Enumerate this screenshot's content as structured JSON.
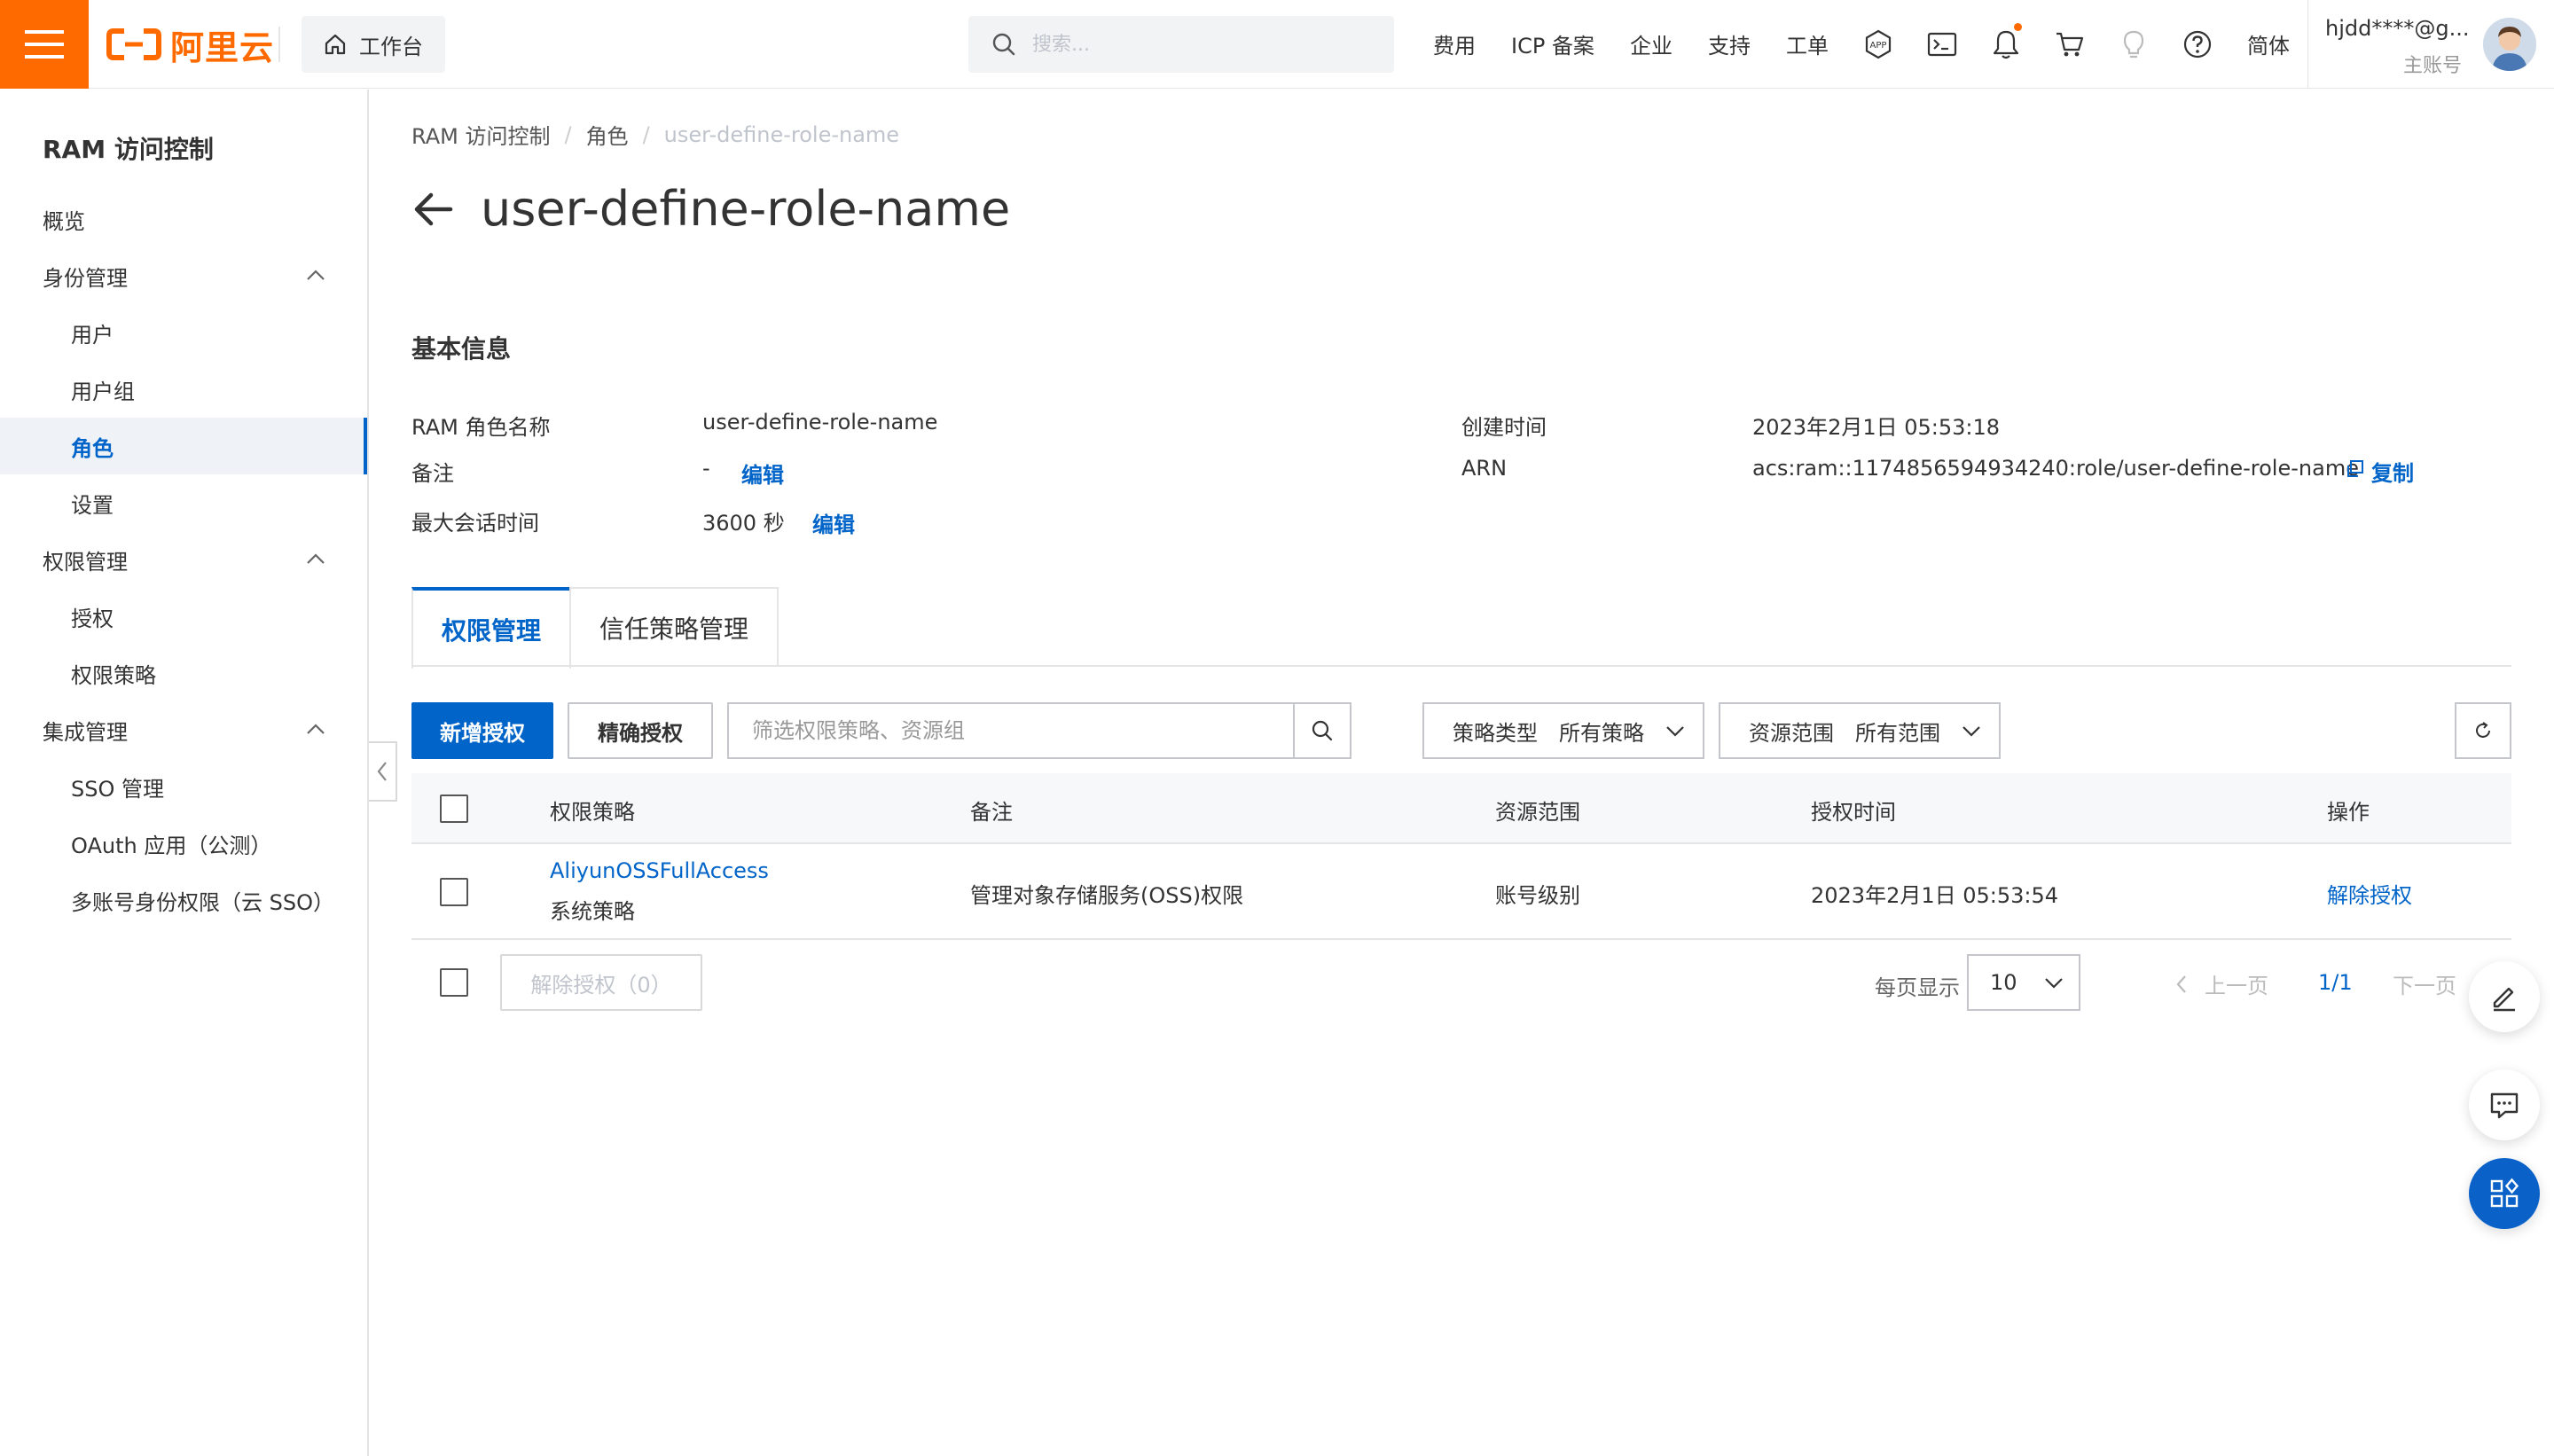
{
  "topbar": {
    "logo_text": "阿里云",
    "workbench_label": "工作台",
    "search_placeholder": "搜索...",
    "nav_links": [
      "费用",
      "ICP 备案",
      "企业",
      "支持",
      "工单"
    ],
    "language": "简体",
    "user_name": "hjdd****@g...",
    "user_role": "主账号",
    "icons": [
      "menu-icon",
      "home-icon",
      "search-icon",
      "app-icon",
      "terminal-icon",
      "bell-icon",
      "cart-icon",
      "lightbulb-icon",
      "help-icon"
    ]
  },
  "sidebar": {
    "title": "RAM 访问控制",
    "items": [
      {
        "label": "概览"
      },
      {
        "label": "身份管理"
      },
      {
        "label": "用户"
      },
      {
        "label": "用户组"
      },
      {
        "label": "角色"
      },
      {
        "label": "设置"
      },
      {
        "label": "权限管理"
      },
      {
        "label": "授权"
      },
      {
        "label": "权限策略"
      },
      {
        "label": "集成管理"
      },
      {
        "label": "SSO 管理"
      },
      {
        "label": "OAuth 应用（公测）"
      },
      {
        "label": "多账号身份权限（云 SSO）"
      }
    ]
  },
  "breadcrumb": {
    "items": [
      "RAM 访问控制",
      "角色",
      "user-define-role-name"
    ],
    "separator": "/"
  },
  "page": {
    "title": "user-define-role-name"
  },
  "basic_info": {
    "section_title": "基本信息",
    "role_name_label": "RAM 角色名称",
    "role_name_value": "user-define-role-name",
    "remark_label": "备注",
    "remark_value": "-",
    "edit_label": "编辑",
    "max_session_label": "最大会话时间",
    "max_session_value": "3600 秒",
    "created_label": "创建时间",
    "created_value": "2023年2月1日 05:53:18",
    "arn_label": "ARN",
    "arn_value": "acs:ram::1174856594934240:role/user-define-role-name",
    "copy_label": "复制"
  },
  "tabs": [
    {
      "label": "权限管理"
    },
    {
      "label": "信任策略管理"
    }
  ],
  "toolbar": {
    "add_grant_label": "新增授权",
    "precise_grant_label": "精确授权",
    "filter_placeholder": "筛选权限策略、资源组",
    "policy_type_label": "策略类型",
    "policy_type_value": "所有策略",
    "resource_scope_label": "资源范围",
    "resource_scope_value": "所有范围"
  },
  "table": {
    "columns": [
      "权限策略",
      "备注",
      "资源范围",
      "授权时间",
      "操作"
    ],
    "rows": [
      {
        "policy_name": "AliyunOSSFullAccess",
        "policy_type": "系统策略",
        "remark": "管理对象存储服务(OSS)权限",
        "scope": "账号级别",
        "granted_at": "2023年2月1日 05:53:54",
        "action": "解除授权"
      }
    ]
  },
  "footer": {
    "bulk_revoke_label": "解除授权（0）",
    "page_size_label": "每页显示",
    "page_size_value": "10",
    "prev_label": "上一页",
    "page_indicator": "1/1",
    "next_label": "下一页"
  },
  "colors": {
    "brand": "#ff6a00",
    "primary": "#0064c8",
    "active_bg": "#eff3f8"
  }
}
